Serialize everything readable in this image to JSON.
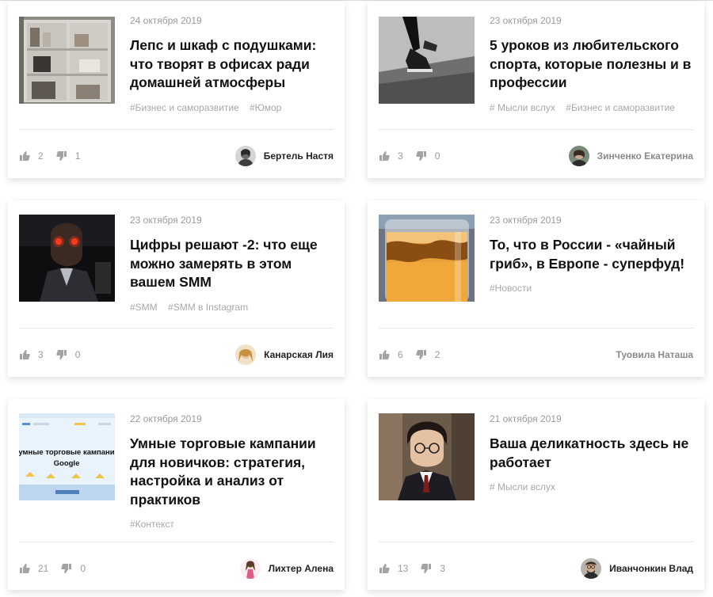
{
  "cards": [
    {
      "date": "24 октября 2019",
      "title": "Лепс и шкаф с подушками: что творят в офисах ради домашней атмосферы",
      "tags": [
        "#Бизнес и саморазвитие",
        "#Юмор"
      ],
      "likes": "2",
      "dislikes": "1",
      "author": "Бертель Настя"
    },
    {
      "date": "23 октября 2019",
      "title": "5 уроков из любительского спорта, которые полезны и в профессии",
      "tags": [
        "# Мысли вслух",
        "#Бизнес и саморазвитие"
      ],
      "likes": "3",
      "dislikes": "0",
      "author": "Зинченко Екатерина"
    },
    {
      "date": "23 октября 2019",
      "title": "Цифры решают -2: что еще можно замерять в этом вашем SMM",
      "tags": [
        "#SMM",
        "#SMM в Instagram"
      ],
      "likes": "3",
      "dislikes": "0",
      "author": "Канарская Лия"
    },
    {
      "date": "23 октября 2019",
      "title": "То, что в России - «чайный гриб», в Европе - суперфуд!",
      "tags": [
        "#Новости"
      ],
      "likes": "6",
      "dislikes": "2",
      "author": "Туовила Наташа"
    },
    {
      "date": "22 октября 2019",
      "title": "Умные торговые кампании для новичков: стратегия, настройка и анализ от практиков",
      "tags": [
        "#Контекст"
      ],
      "likes": "21",
      "dislikes": "0",
      "author": "Лихтер Алена",
      "thumb_text": [
        "умные торговые кампани",
        "Google"
      ]
    },
    {
      "date": "21 октября 2019",
      "title": "Ваша деликатность здесь не работает",
      "tags": [
        "# Мысли вслух"
      ],
      "likes": "13",
      "dislikes": "3",
      "author": "Иванчонкин Влад"
    }
  ],
  "icons": {
    "like": "thumbs-up-icon",
    "dislike": "thumbs-down-icon"
  },
  "colors": {
    "meta_gray": "#9a9a9a",
    "title": "#111111",
    "divider": "#e6e6e6"
  }
}
